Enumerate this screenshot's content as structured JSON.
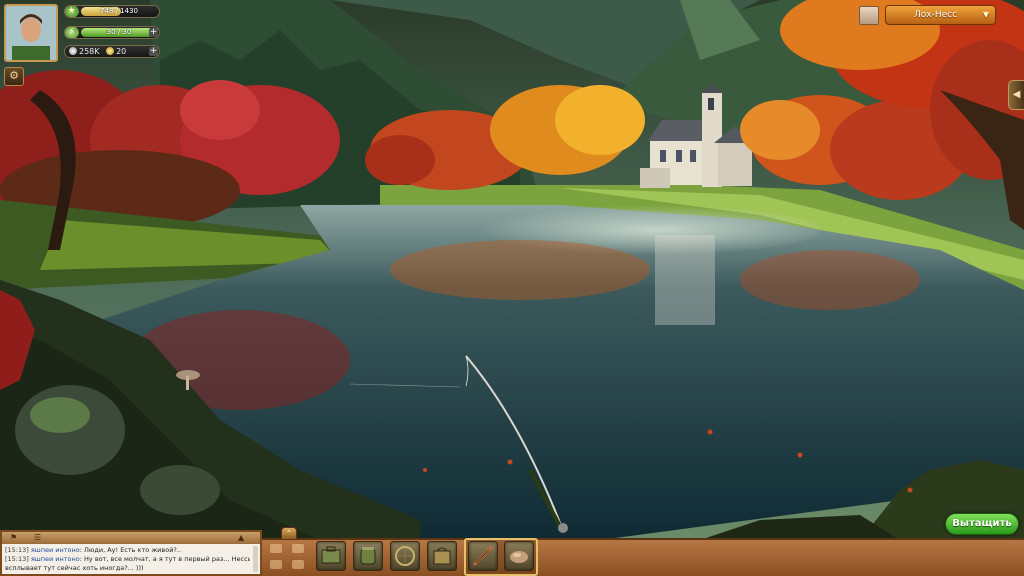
{
  "player": {
    "xp_text": "748 / 1430",
    "xp_progress": 0.52,
    "energy_text": "30 / 30",
    "energy_progress": 1.0,
    "silver": "258K",
    "gold": "20"
  },
  "location": {
    "name": "Лох-Несс"
  },
  "actions": {
    "pull_label": "Вытащить"
  },
  "chat": {
    "messages": [
      {
        "time": "[15:13]",
        "user": "яшпеи интоно",
        "text": ": Люди, Ау! Есть кто живой?.."
      },
      {
        "time": "[15:13]",
        "user": "яшпеи интоно",
        "text": ": Ну вот, все молчат, а я тут в первый раз... Несси-то хоть"
      },
      {
        "time": "",
        "user": "",
        "text": "всплывает тут сейчас хоть иногда?... )))"
      }
    ]
  },
  "colors": {
    "pull_button": "#2a9a1a",
    "location_select": "#d17f22",
    "bottom_bar": "#a0622f"
  },
  "icons": {
    "settings": "gear-icon",
    "map": "map-icon",
    "side_panel": "chevron-left-icon",
    "collapse": "chevron-up-icon"
  }
}
